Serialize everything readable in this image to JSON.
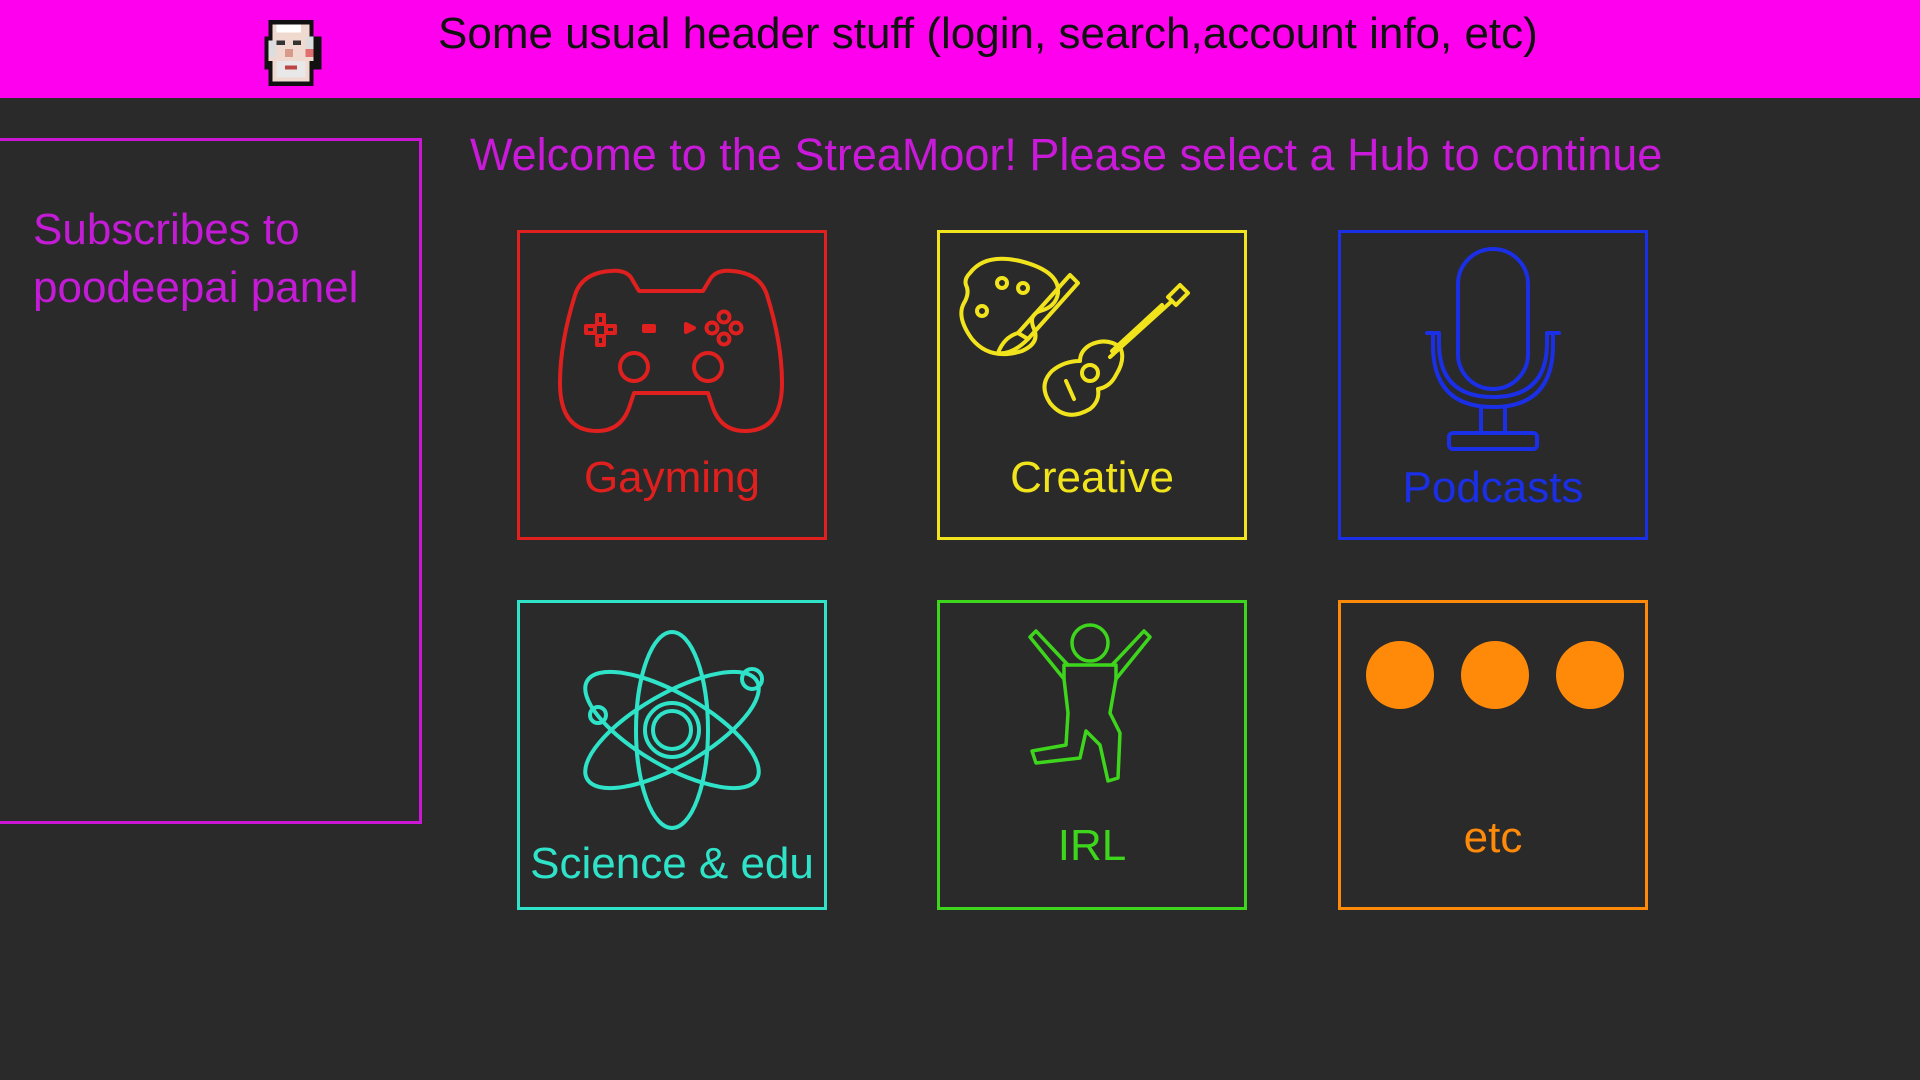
{
  "header": {
    "text": "Some usual header stuff (login, search,account info, etc)",
    "background": "#ff00ee"
  },
  "sidebar": {
    "panel_text_line1": "Subscribes to",
    "panel_text_line2": "poodeepai panel",
    "color": "#c41bd6"
  },
  "main": {
    "welcome": "Welcome to the StreaMoor! Please select a Hub to continue",
    "hubs": [
      {
        "label": "Gayming",
        "icon": "gamepad-icon",
        "color": "#e0201f"
      },
      {
        "label": "Creative",
        "icon": "palette-guitar-icon",
        "color": "#f2e41c"
      },
      {
        "label": "Podcasts",
        "icon": "microphone-icon",
        "color": "#1a2fe6"
      },
      {
        "label": "Science & edu",
        "icon": "atom-icon",
        "color": "#2fe3c8"
      },
      {
        "label": "IRL",
        "icon": "jumping-person-icon",
        "color": "#3ed61c"
      },
      {
        "label": "etc",
        "icon": "dots-icon",
        "color": "#ff8a0a"
      }
    ]
  }
}
